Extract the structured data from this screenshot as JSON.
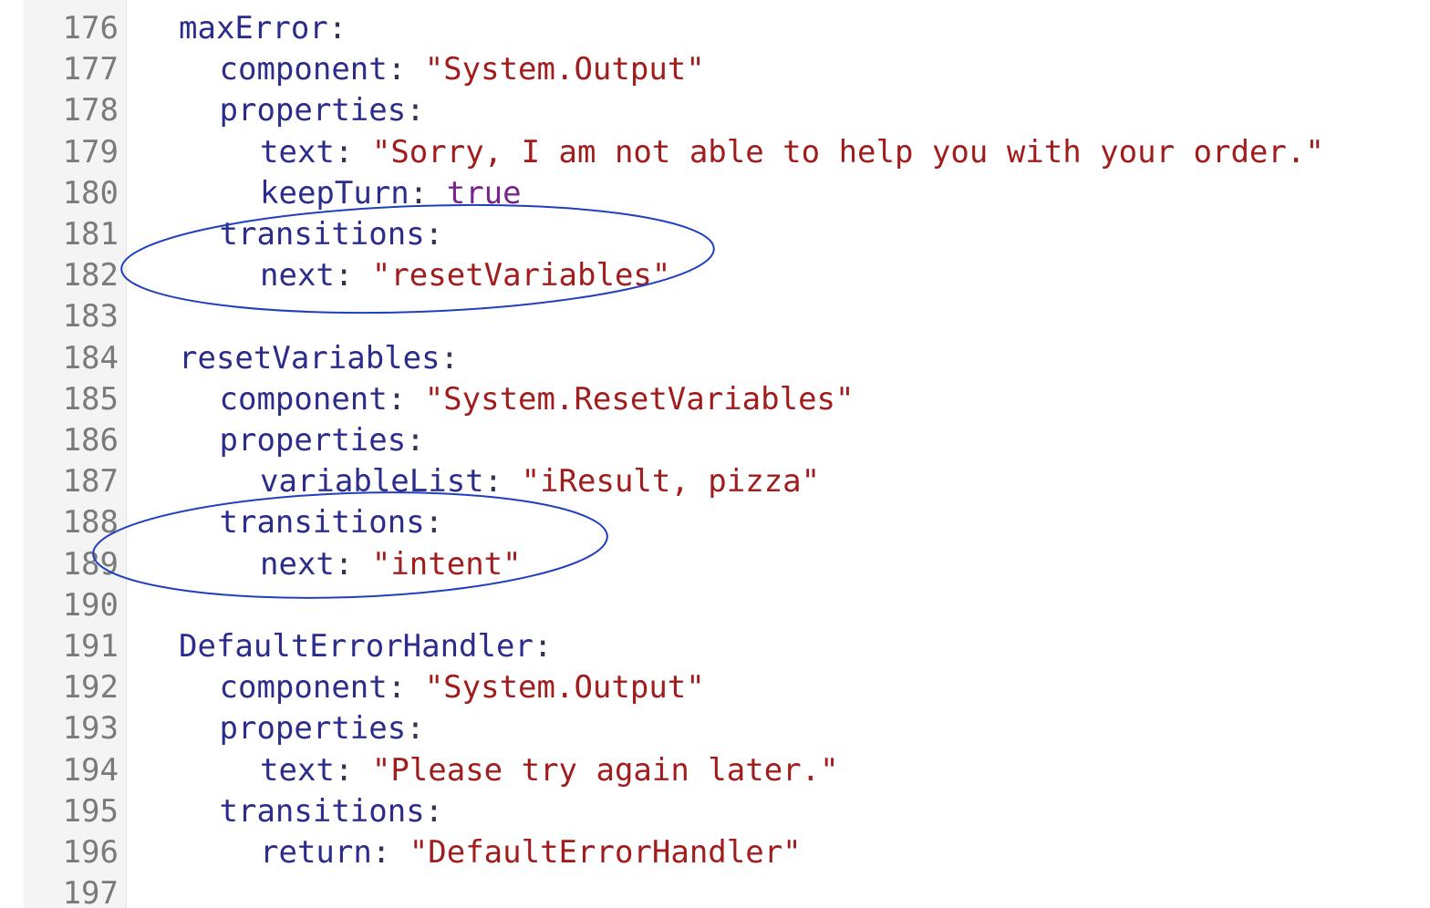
{
  "editor": {
    "lines": [
      {
        "num": "176",
        "indent": 0,
        "key": "maxError",
        "sep": ":",
        "value": "",
        "vtype": ""
      },
      {
        "num": "177",
        "indent": 1,
        "key": "component",
        "sep": ": ",
        "value": "\"System.Output\"",
        "vtype": "string"
      },
      {
        "num": "178",
        "indent": 1,
        "key": "properties",
        "sep": ":",
        "value": "",
        "vtype": ""
      },
      {
        "num": "179",
        "indent": 2,
        "key": "text",
        "sep": ": ",
        "value": "\"Sorry, I am not able to help you with your order.\"",
        "vtype": "string"
      },
      {
        "num": "180",
        "indent": 2,
        "key": "keepTurn",
        "sep": ": ",
        "value": "true",
        "vtype": "bool"
      },
      {
        "num": "181",
        "indent": 1,
        "key": "transitions",
        "sep": ":",
        "value": "",
        "vtype": ""
      },
      {
        "num": "182",
        "indent": 2,
        "key": "next",
        "sep": ": ",
        "value": "\"resetVariables\"",
        "vtype": "string"
      },
      {
        "num": "183",
        "indent": 0,
        "key": "",
        "sep": "",
        "value": "",
        "vtype": ""
      },
      {
        "num": "184",
        "indent": 0,
        "key": "resetVariables",
        "sep": ":",
        "value": "",
        "vtype": ""
      },
      {
        "num": "185",
        "indent": 1,
        "key": "component",
        "sep": ": ",
        "value": "\"System.ResetVariables\"",
        "vtype": "string"
      },
      {
        "num": "186",
        "indent": 1,
        "key": "properties",
        "sep": ":",
        "value": "",
        "vtype": ""
      },
      {
        "num": "187",
        "indent": 2,
        "key": "variableList",
        "sep": ": ",
        "value": "\"iResult, pizza\"",
        "vtype": "string"
      },
      {
        "num": "188",
        "indent": 1,
        "key": "transitions",
        "sep": ":",
        "value": "",
        "vtype": ""
      },
      {
        "num": "189",
        "indent": 2,
        "key": "next",
        "sep": ": ",
        "value": "\"intent\"",
        "vtype": "string"
      },
      {
        "num": "190",
        "indent": 0,
        "key": "",
        "sep": "",
        "value": "",
        "vtype": ""
      },
      {
        "num": "191",
        "indent": 0,
        "key": "DefaultErrorHandler",
        "sep": ":",
        "value": "",
        "vtype": ""
      },
      {
        "num": "192",
        "indent": 1,
        "key": "component",
        "sep": ": ",
        "value": "\"System.Output\"",
        "vtype": "string"
      },
      {
        "num": "193",
        "indent": 1,
        "key": "properties",
        "sep": ":",
        "value": "",
        "vtype": ""
      },
      {
        "num": "194",
        "indent": 2,
        "key": "text",
        "sep": ": ",
        "value": "\"Please try again later.\"",
        "vtype": "string"
      },
      {
        "num": "195",
        "indent": 1,
        "key": "transitions",
        "sep": ":",
        "value": "",
        "vtype": ""
      },
      {
        "num": "196",
        "indent": 2,
        "key": "return",
        "sep": ": ",
        "value": "\"DefaultErrorHandler\"",
        "vtype": "string"
      },
      {
        "num": "197",
        "indent": 0,
        "key": "",
        "sep": "",
        "value": "",
        "vtype": ""
      }
    ]
  },
  "colors": {
    "gutter_bg": "#f4f4f4",
    "line_number": "#7a7a7a",
    "key": "#2c2c8c",
    "string": "#a11c1c",
    "boolean": "#7a238c",
    "annotation": "#1f3fbf"
  }
}
